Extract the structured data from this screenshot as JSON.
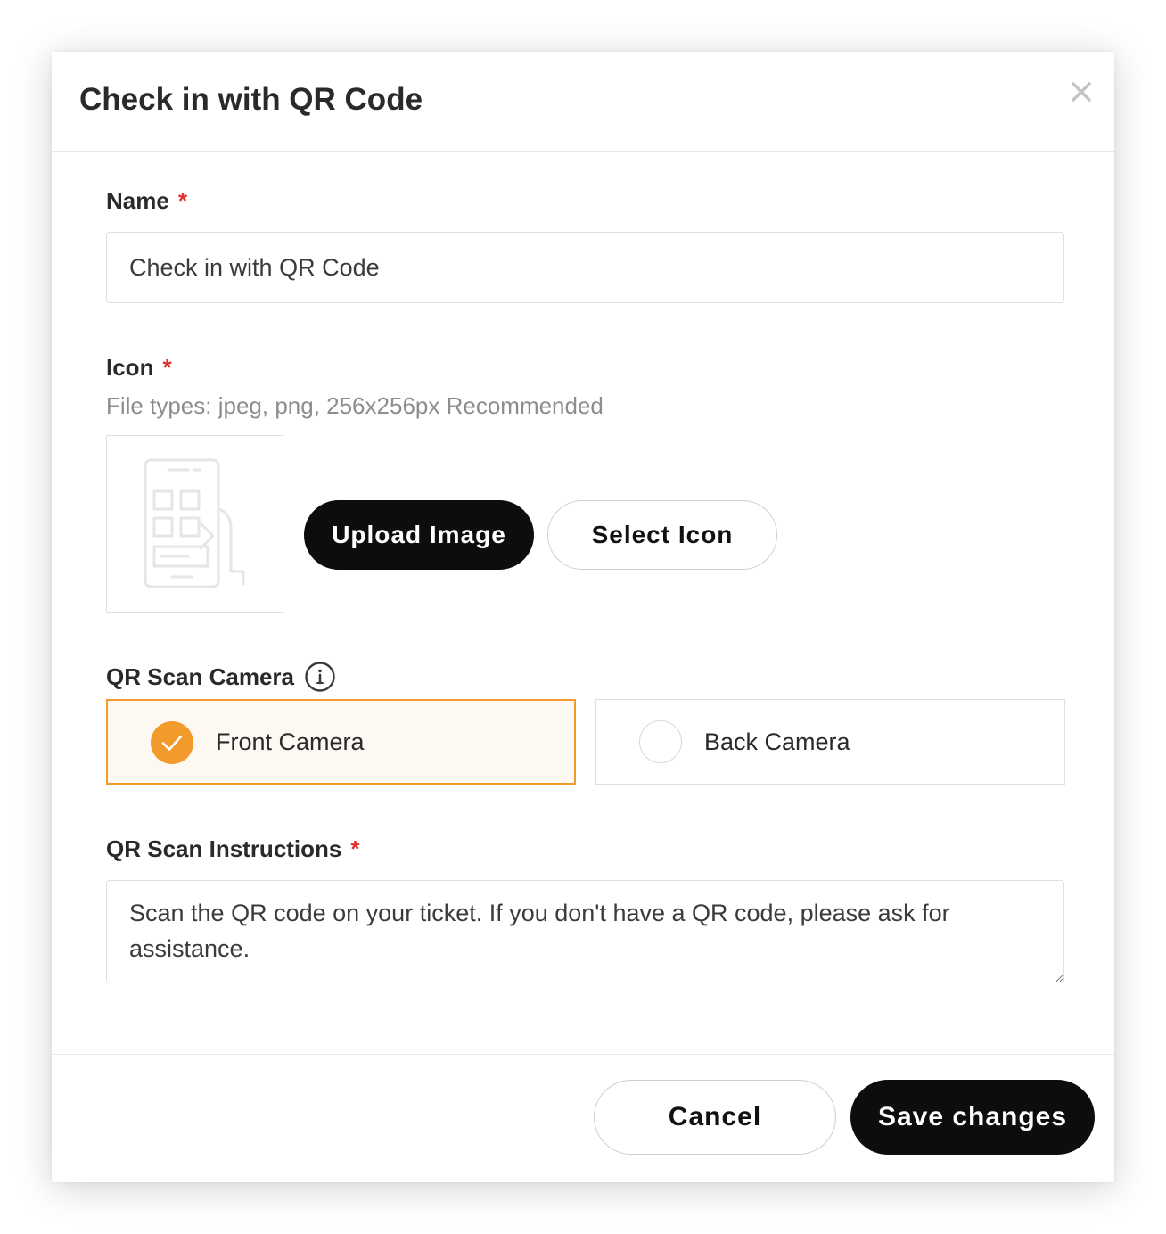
{
  "modal": {
    "title": "Check in with QR Code",
    "close_icon": "close-icon"
  },
  "name_field": {
    "label": "Name",
    "required_mark": "*",
    "value": "Check in with QR Code"
  },
  "icon_field": {
    "label": "Icon",
    "required_mark": "*",
    "hint": "File types: jpeg, png, 256x256px Recommended",
    "preview_icon": "qr-kiosk-icon",
    "upload_label": "Upload Image",
    "select_label": "Select Icon"
  },
  "camera_field": {
    "label": "QR Scan Camera",
    "info_icon": "info-icon",
    "options": [
      {
        "label": "Front Camera",
        "selected": true
      },
      {
        "label": "Back Camera",
        "selected": false
      }
    ]
  },
  "instructions_field": {
    "label": "QR Scan Instructions",
    "required_mark": "*",
    "value": "Scan the QR code on your ticket. If you don't have a QR code, please ask for assistance."
  },
  "footer": {
    "cancel_label": "Cancel",
    "save_label": "Save changes"
  },
  "colors": {
    "accent": "#f39a2c",
    "required": "#e0312f",
    "primary_button": "#0d0d0d"
  }
}
